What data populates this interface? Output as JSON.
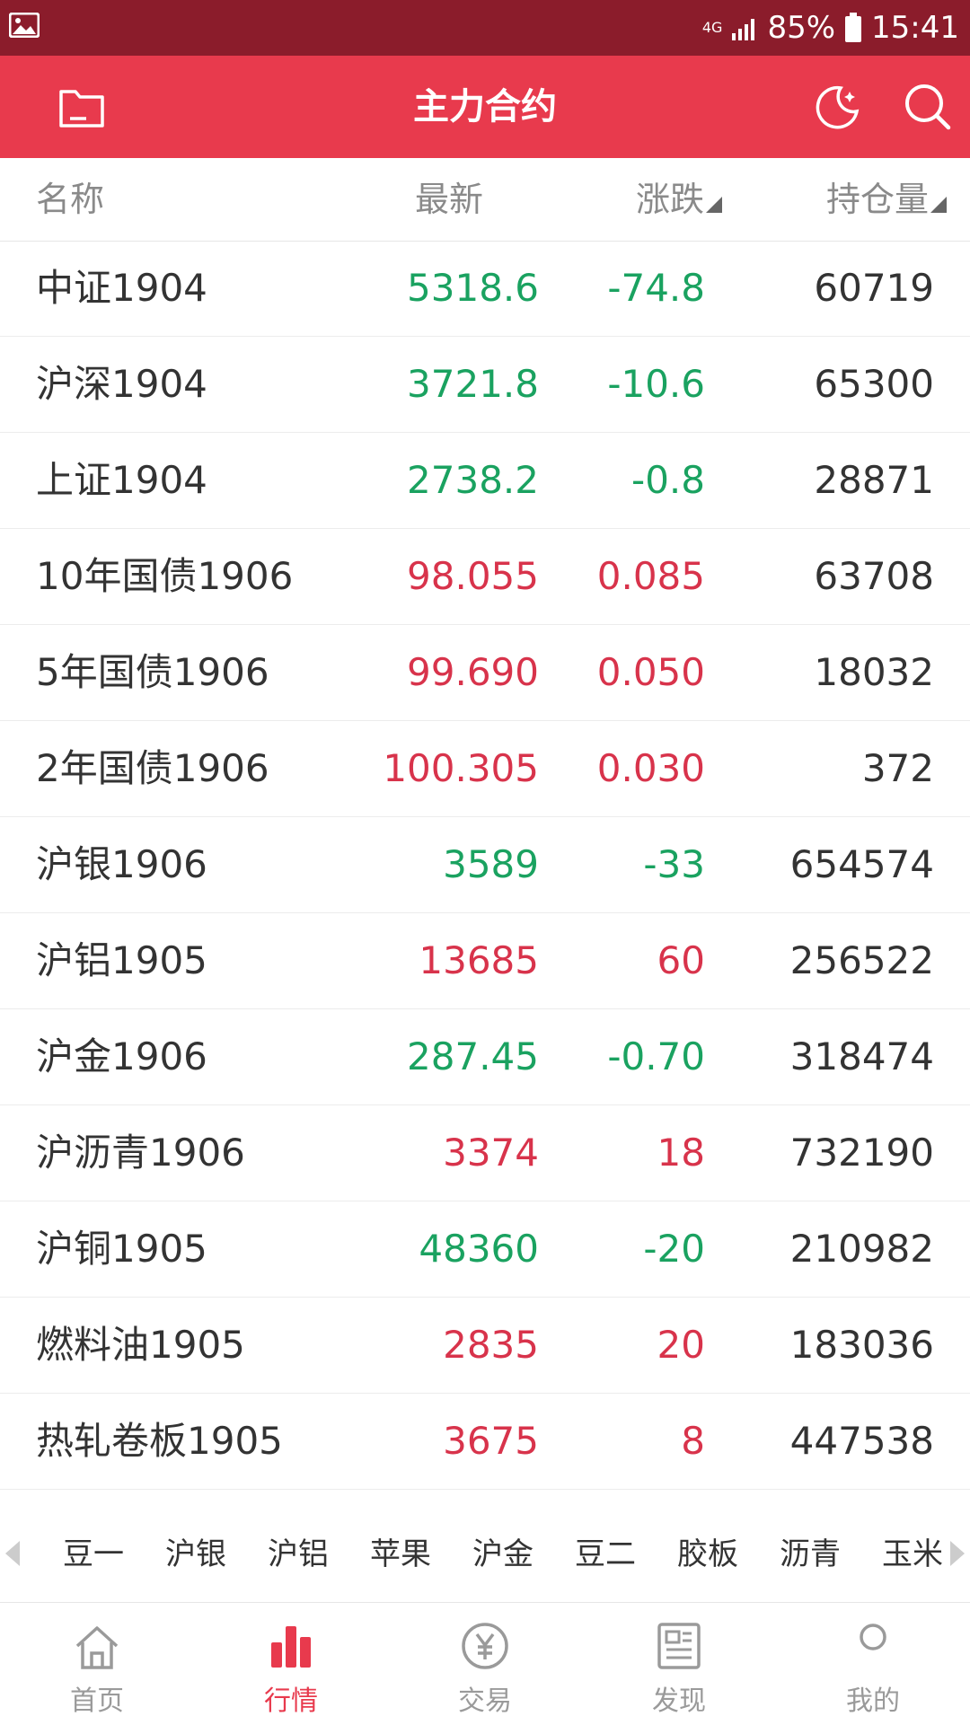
{
  "status_bar": {
    "network": "4G",
    "battery": "85%",
    "time": "15:41"
  },
  "header": {
    "title": "主力合约"
  },
  "columns": {
    "name": "名称",
    "last": "最新",
    "change": "涨跌",
    "open_interest": "持仓量"
  },
  "rows": [
    {
      "name": "中证1904",
      "last": "5318.6",
      "change": "-74.8",
      "oi": "60719",
      "direction": "down"
    },
    {
      "name": "沪深1904",
      "last": "3721.8",
      "change": "-10.6",
      "oi": "65300",
      "direction": "down"
    },
    {
      "name": "上证1904",
      "last": "2738.2",
      "change": "-0.8",
      "oi": "28871",
      "direction": "down"
    },
    {
      "name": "10年国债1906",
      "last": "98.055",
      "change": "0.085",
      "oi": "63708",
      "direction": "up"
    },
    {
      "name": "5年国债1906",
      "last": "99.690",
      "change": "0.050",
      "oi": "18032",
      "direction": "up"
    },
    {
      "name": "2年国债1906",
      "last": "100.305",
      "change": "0.030",
      "oi": "372",
      "direction": "up"
    },
    {
      "name": "沪银1906",
      "last": "3589",
      "change": "-33",
      "oi": "654574",
      "direction": "down"
    },
    {
      "name": "沪铝1905",
      "last": "13685",
      "change": "60",
      "oi": "256522",
      "direction": "up"
    },
    {
      "name": "沪金1906",
      "last": "287.45",
      "change": "-0.70",
      "oi": "318474",
      "direction": "down"
    },
    {
      "name": "沪沥青1906",
      "last": "3374",
      "change": "18",
      "oi": "732190",
      "direction": "up"
    },
    {
      "name": "沪铜1905",
      "last": "48360",
      "change": "-20",
      "oi": "210982",
      "direction": "down"
    },
    {
      "name": "燃料油1905",
      "last": "2835",
      "change": "20",
      "oi": "183036",
      "direction": "up"
    },
    {
      "name": "热轧卷板1905",
      "last": "3675",
      "change": "8",
      "oi": "447538",
      "direction": "up"
    }
  ],
  "category_tabs": [
    "豆一",
    "沪银",
    "沪铝",
    "苹果",
    "沪金",
    "豆二",
    "胶板",
    "沥青",
    "玉米"
  ],
  "bottom_nav": [
    {
      "label": "首页",
      "icon": "home-icon",
      "active": false
    },
    {
      "label": "行情",
      "icon": "market-chart-icon",
      "active": true
    },
    {
      "label": "交易",
      "icon": "yuan-coin-icon",
      "active": false
    },
    {
      "label": "发现",
      "icon": "news-icon",
      "active": false
    },
    {
      "label": "我的",
      "icon": "user-icon",
      "active": false
    }
  ],
  "colors": {
    "header_bg": "#e83a4d",
    "status_bg": "#8b1c2b",
    "up": "#d8334b",
    "down": "#1aa260",
    "nav_active": "#e83a4d",
    "nav_inactive": "#9a9a9a"
  }
}
